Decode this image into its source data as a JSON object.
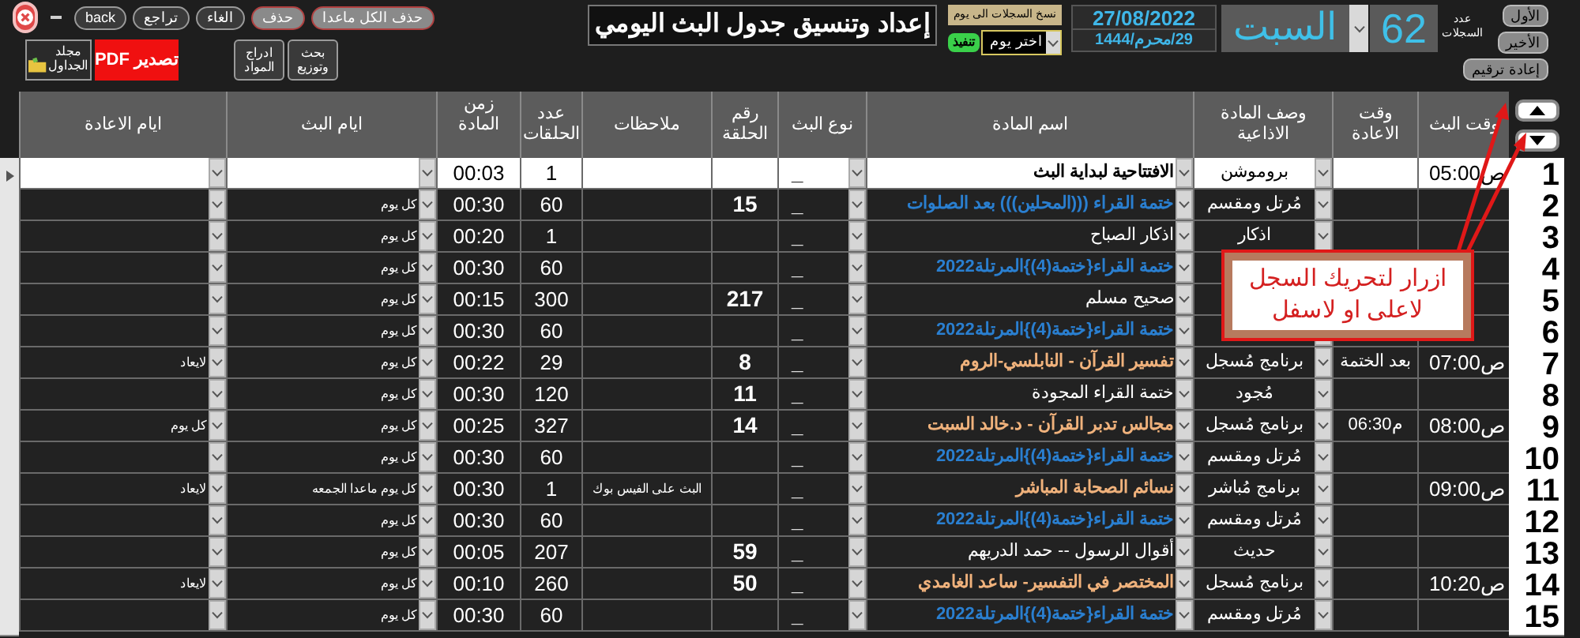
{
  "toolbar_buttons": [
    {
      "label": "حذف الكل ماعدا",
      "kind": "danger"
    },
    {
      "label": "حذف",
      "kind": "danger"
    },
    {
      "label": "الغاء",
      "kind": "plain"
    },
    {
      "label": "تراجع",
      "kind": "plain"
    },
    {
      "label": "back",
      "kind": "plain"
    }
  ],
  "tool_buttons": [
    {
      "label": "بحث وتوزيع",
      "kind": "plain"
    },
    {
      "label": "ادراج المواد",
      "kind": "plain"
    },
    {
      "label": "تصدير PDF",
      "kind": "export"
    },
    {
      "label": "مجلد الجداول",
      "kind": "folder"
    }
  ],
  "title": "إعداد وتنسيق جدول البث اليومي",
  "copy_to_day": {
    "label": "نسخ السجلات الى يوم",
    "value": "اختر يوم",
    "button": "تنفيذ"
  },
  "date": {
    "gregorian": "27/08/2022",
    "hijri": "29/محرم/1444"
  },
  "day": "السبت",
  "record_count": {
    "label": "عدد السجلات",
    "value": "62"
  },
  "nav_buttons": [
    "الأول",
    "الأخير",
    "إعادة ترقيم"
  ],
  "columns": [
    "وقت البث",
    "وقت الاعادة",
    "وصف المادة الاذاعية",
    "اسم المادة",
    "نوع البث",
    "رقم الحلقة",
    "ملاحظات",
    "عدد الحلقات",
    "زمن المادة",
    "ايام البث",
    "ايام الاعادة"
  ],
  "rows": [
    {
      "number": "1",
      "current": true,
      "time": "05:00ص",
      "desc": "بروموشن",
      "name": "الافتتاحية لبداية البث",
      "color": "#000000",
      "type": "_",
      "count": "1",
      "duration": "00:03"
    },
    {
      "number": "2",
      "current": false,
      "desc": "مُرتل ومقسم",
      "name": "ختمة القراء (((المحلين))) بعد الصلوات",
      "color": "#2a7fd0",
      "type": "_",
      "episode": "15",
      "count": "60",
      "duration": "00:30",
      "days": "كل يوم"
    },
    {
      "number": "3",
      "current": false,
      "desc": "اذكار",
      "name": "اذكار الصباح",
      "color": "#ffffff",
      "type": "_",
      "count": "1",
      "duration": "00:20",
      "days": "كل يوم"
    },
    {
      "number": "4",
      "current": false,
      "name": "ختمة القراء{ختمة(4)}المرتلة2022",
      "color": "#2a7fd0",
      "type": "_",
      "count": "60",
      "duration": "00:30",
      "days": "كل يوم"
    },
    {
      "number": "5",
      "current": false,
      "name": "صحيح مسلم",
      "color": "#ffffff",
      "type": "_",
      "episode": "217",
      "count": "300",
      "duration": "00:15",
      "days": "كل يوم"
    },
    {
      "number": "6",
      "current": false,
      "name": "ختمة القراء{ختمة(4)}المرتلة2022",
      "color": "#2a7fd0",
      "type": "_",
      "count": "60",
      "duration": "00:30",
      "days": "كل يوم"
    },
    {
      "number": "7",
      "current": false,
      "time": "07:00ص",
      "rerun_time": "بعد الختمة",
      "desc": "برنامج مُسجل",
      "name": "تفسير القرآن - النابلسي-الروم",
      "color": "#f0b27c",
      "type": "_",
      "episode": "8",
      "count": "29",
      "duration": "00:22",
      "days": "كل يوم",
      "rerun_days": "لايعاد"
    },
    {
      "number": "8",
      "current": false,
      "desc": "مُجود",
      "name": "ختمة القراء المجودة",
      "color": "#ffffff",
      "type": "_",
      "episode": "11",
      "count": "120",
      "duration": "00:30",
      "days": "كل يوم"
    },
    {
      "number": "9",
      "current": false,
      "time": "08:00ص",
      "rerun_time": "06:30م",
      "desc": "برنامج مُسجل",
      "name": "مجالس تدبر القرآن - د.خالد السبت",
      "color": "#f0b27c",
      "type": "_",
      "episode": "14",
      "count": "327",
      "duration": "00:25",
      "days": "كل يوم",
      "rerun_days": "كل يوم"
    },
    {
      "number": "10",
      "current": false,
      "desc": "مُرتل ومقسم",
      "name": "ختمة القراء{ختمة(4)}المرتلة2022",
      "color": "#2a7fd0",
      "type": "_",
      "count": "60",
      "duration": "00:30",
      "days": "كل يوم"
    },
    {
      "number": "11",
      "current": false,
      "time": "09:00ص",
      "desc": "برنامج مُباشر",
      "name": "نسائم الصحابة المباشر",
      "color": "#f0b27c",
      "type": "_",
      "notes": "البث على الفيس بوك",
      "count": "1",
      "duration": "00:30",
      "days": "كل يوم ماعدا الجمعه",
      "rerun_days": "لايعاد"
    },
    {
      "number": "12",
      "current": false,
      "desc": "مُرتل ومقسم",
      "name": "ختمة القراء{ختمة(4)}المرتلة2022",
      "color": "#2a7fd0",
      "type": "_",
      "count": "60",
      "duration": "00:30",
      "days": "كل يوم"
    },
    {
      "number": "13",
      "current": false,
      "desc": "حديث",
      "name": "أقوال الرسول -- حمد الدريهم",
      "color": "#ffffff",
      "type": "_",
      "episode": "59",
      "count": "207",
      "duration": "00:05",
      "days": "كل يوم"
    },
    {
      "number": "14",
      "current": false,
      "time": "10:20ص",
      "desc": "برنامج مُسجل",
      "name": "المختصر في التفسير- ساعد الغامدي",
      "color": "#f0b27c",
      "type": "_",
      "episode": "50",
      "count": "260",
      "duration": "00:10",
      "days": "كل يوم",
      "rerun_days": "لايعاد"
    },
    {
      "number": "15",
      "current": false,
      "desc": "مُرتل ومقسم",
      "name": "ختمة القراء{ختمة(4)}المرتلة2022",
      "color": "#2a7fd0",
      "type": "_",
      "count": "60",
      "duration": "00:30",
      "days": "كل يوم"
    }
  ],
  "callout": {
    "text": "ازرار لتحريك السجل لاعلى او لاسفل"
  }
}
